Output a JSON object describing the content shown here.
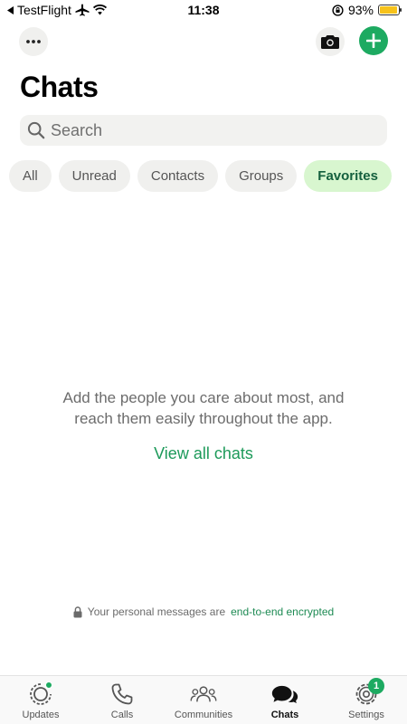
{
  "status_bar": {
    "carrier": "TestFlight",
    "time": "11:38",
    "battery_percent": "93%",
    "battery_level": 0.93,
    "back_icon": "back-triangle-icon",
    "airplane_icon": "airplane-icon",
    "wifi_icon": "wifi-icon",
    "rotation_lock_icon": "rotation-lock-icon"
  },
  "top_actions": {
    "menu_icon": "ellipsis-icon",
    "camera_icon": "camera-icon",
    "add_icon": "plus-icon"
  },
  "title": "Chats",
  "search": {
    "placeholder": "Search",
    "value": ""
  },
  "filters": [
    {
      "label": "All",
      "active": false
    },
    {
      "label": "Unread",
      "active": false
    },
    {
      "label": "Contacts",
      "active": false
    },
    {
      "label": "Groups",
      "active": false
    },
    {
      "label": "Favorites",
      "active": true
    }
  ],
  "empty_state": {
    "message": "Add the people you care about most, and reach them easily throughout the app.",
    "action": "View all chats"
  },
  "encryption": {
    "prefix": "Your personal messages are",
    "link": "end-to-end encrypted"
  },
  "bottom_nav": [
    {
      "label": "Updates",
      "icon": "updates-icon",
      "active": false,
      "dot": true
    },
    {
      "label": "Calls",
      "icon": "phone-icon",
      "active": false
    },
    {
      "label": "Communities",
      "icon": "communities-icon",
      "active": false
    },
    {
      "label": "Chats",
      "icon": "chats-icon",
      "active": true
    },
    {
      "label": "Settings",
      "icon": "gear-icon",
      "active": false,
      "badge": "1"
    }
  ],
  "colors": {
    "accent": "#1daa61",
    "active_chip_bg": "#d8f6cf",
    "active_chip_text": "#15603e",
    "link": "#1d9a5a"
  }
}
